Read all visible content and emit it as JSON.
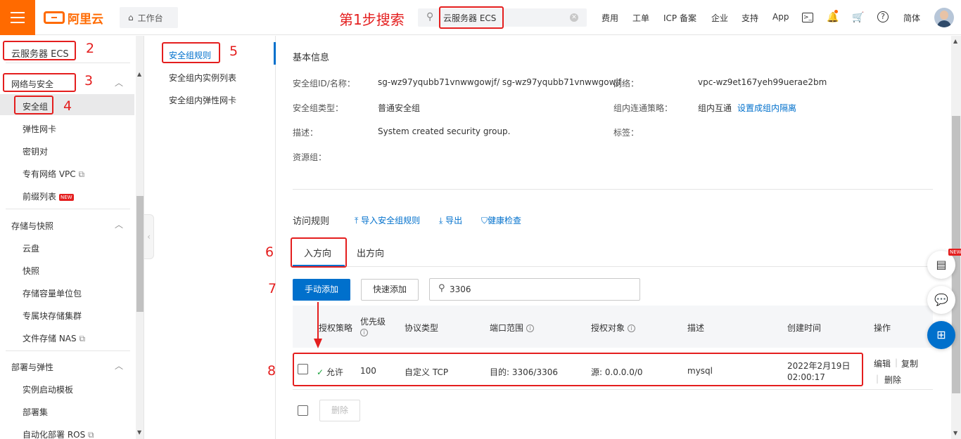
{
  "topbar": {
    "logo": "阿里云",
    "workbench": "工作台",
    "search_value": "云服务器 ECS",
    "nav": [
      "费用",
      "工单",
      "ICP 备案",
      "企业",
      "支持",
      "App"
    ],
    "lang": "简体"
  },
  "annotations": {
    "step1": "第1步搜索",
    "n2": "2",
    "n3": "3",
    "n4": "4",
    "n5": "5",
    "n6": "6",
    "n7": "7",
    "n8": "8"
  },
  "sidebar": {
    "product": "云服务器 ECS",
    "group1": "网络与安全",
    "g1_items": [
      "安全组",
      "弹性网卡",
      "密钥对",
      "专有网络 VPC",
      "前缀列表"
    ],
    "new_tag": "NEW",
    "group2": "存储与快照",
    "g2_items": [
      "云盘",
      "快照",
      "存储容量单位包",
      "专属块存储集群",
      "文件存储 NAS"
    ],
    "group3": "部署与弹性",
    "g3_items": [
      "实例启动模板",
      "部署集",
      "自动化部署 ROS"
    ]
  },
  "subnav": {
    "items": [
      "安全组规则",
      "安全组内实例列表",
      "安全组内弹性网卡"
    ]
  },
  "basic": {
    "title": "基本信息",
    "id_label": "安全组ID/名称：",
    "id_value": "sg-wz97yqubb71vnwwgowjf/ sg-wz97yqubb71vnwwgowjf",
    "net_label": "网络：",
    "net_value": "vpc-wz9et167yeh99uerae2bm",
    "type_label": "安全组类型：",
    "type_value": "普通安全组",
    "policy_label": "组内连通策略：",
    "policy_value": "组内互通",
    "policy_link": "设置成组内隔离",
    "desc_label": "描述：",
    "desc_value": "System created security group.",
    "tag_label": "标签：",
    "rg_label": "资源组："
  },
  "rules": {
    "title": "访问规则",
    "import": "导入安全组规则",
    "export": "导出",
    "health": "健康检查",
    "tab_in": "入方向",
    "tab_out": "出方向",
    "add_manual": "手动添加",
    "add_quick": "快速添加",
    "filter_value": "3306"
  },
  "table": {
    "headers": [
      "授权策略",
      "优先级",
      "协议类型",
      "端口范围",
      "授权对象",
      "描述",
      "创建时间",
      "操作"
    ],
    "rows": [
      {
        "policy": "允许",
        "priority": "100",
        "protocol": "自定义 TCP",
        "port": "目的: 3306/3306",
        "source": "源: 0.0.0.0/0",
        "desc": "mysql",
        "created_date": "2022年2月19日",
        "created_time": "02:00:17",
        "edit": "编辑",
        "copy": "复制",
        "delete": "删除"
      }
    ],
    "delete_btn": "删除"
  },
  "float_new": "NEW",
  "colors": {
    "brand": "#ff6a00",
    "link": "#0070cc",
    "annot": "#e41e1e"
  }
}
